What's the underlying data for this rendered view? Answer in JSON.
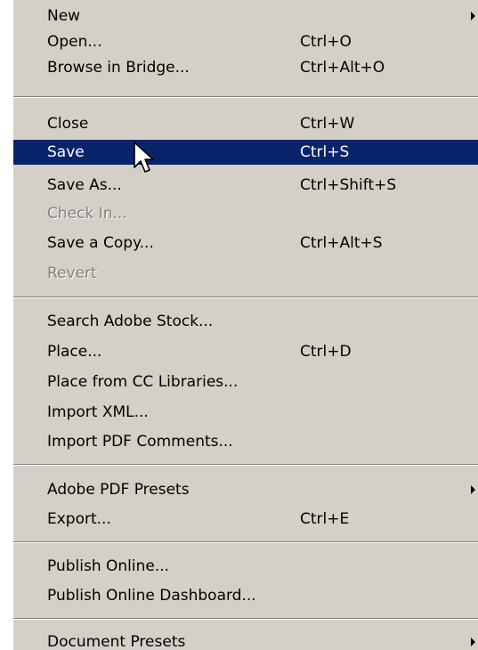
{
  "menu": {
    "items": [
      {
        "label": "New",
        "shortcut": "",
        "submenu": true,
        "disabled": false,
        "highlighted": false
      },
      {
        "label": "Open...",
        "shortcut": "Ctrl+O",
        "submenu": false,
        "disabled": false,
        "highlighted": false
      },
      {
        "label": "Browse in Bridge...",
        "shortcut": "Ctrl+Alt+O",
        "submenu": false,
        "disabled": false,
        "highlighted": false
      },
      {
        "label": "Close",
        "shortcut": "Ctrl+W",
        "submenu": false,
        "disabled": false,
        "highlighted": false
      },
      {
        "label": "Save",
        "shortcut": "Ctrl+S",
        "submenu": false,
        "disabled": false,
        "highlighted": true
      },
      {
        "label": "Save As...",
        "shortcut": "Ctrl+Shift+S",
        "submenu": false,
        "disabled": false,
        "highlighted": false
      },
      {
        "label": "Check In...",
        "shortcut": "",
        "submenu": false,
        "disabled": true,
        "highlighted": false
      },
      {
        "label": "Save a Copy...",
        "shortcut": "Ctrl+Alt+S",
        "submenu": false,
        "disabled": false,
        "highlighted": false
      },
      {
        "label": "Revert",
        "shortcut": "",
        "submenu": false,
        "disabled": true,
        "highlighted": false
      },
      {
        "label": "Search Adobe Stock...",
        "shortcut": "",
        "submenu": false,
        "disabled": false,
        "highlighted": false
      },
      {
        "label": "Place...",
        "shortcut": "Ctrl+D",
        "submenu": false,
        "disabled": false,
        "highlighted": false
      },
      {
        "label": "Place from CC Libraries...",
        "shortcut": "",
        "submenu": false,
        "disabled": false,
        "highlighted": false
      },
      {
        "label": "Import XML...",
        "shortcut": "",
        "submenu": false,
        "disabled": false,
        "highlighted": false
      },
      {
        "label": "Import PDF Comments...",
        "shortcut": "",
        "submenu": false,
        "disabled": false,
        "highlighted": false
      },
      {
        "label": "Adobe PDF Presets",
        "shortcut": "",
        "submenu": true,
        "disabled": false,
        "highlighted": false
      },
      {
        "label": "Export...",
        "shortcut": "Ctrl+E",
        "submenu": false,
        "disabled": false,
        "highlighted": false
      },
      {
        "label": "Publish Online...",
        "shortcut": "",
        "submenu": false,
        "disabled": false,
        "highlighted": false
      },
      {
        "label": "Publish Online Dashboard...",
        "shortcut": "",
        "submenu": false,
        "disabled": false,
        "highlighted": false
      },
      {
        "label": "Document Presets",
        "shortcut": "",
        "submenu": true,
        "disabled": false,
        "highlighted": false
      }
    ]
  },
  "colors": {
    "menu_background": "#d4d0c8",
    "highlight_background": "#0a246a",
    "highlight_text": "#ffffff",
    "disabled_text": "#808080"
  },
  "icons": {
    "submenu_arrow": "chevron-right-icon",
    "cursor": "mouse-pointer-icon"
  }
}
